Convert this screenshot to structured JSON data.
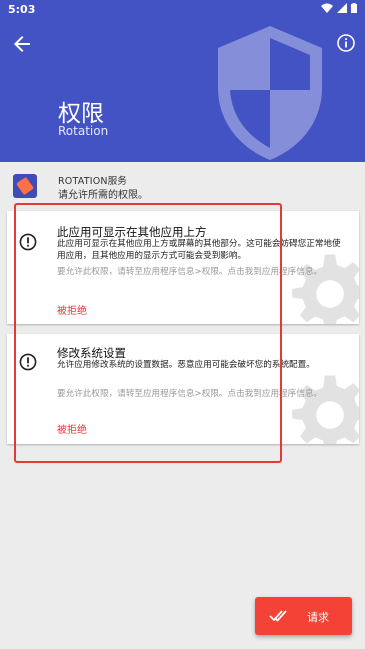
{
  "status_bar": {
    "time": "5:03"
  },
  "header": {
    "title": "权限",
    "subtitle": "Rotation",
    "background": "#4453c3"
  },
  "app_info": {
    "name": "ROTATION服务",
    "description": "请允许所需的权限。"
  },
  "permissions": [
    {
      "title": "此应用可显示在其他应用上方",
      "description": "此应用可显示在其他应用上方或屏幕的其他部分。这可能会妨碍您正常地使用应用，且其他应用的显示方式可能会受到影响。",
      "hint": "要允许此权限，请转至应用程序信息>权限。点击我到应用程序信息。",
      "status": "被拒绝"
    },
    {
      "title": "修改系统设置",
      "description": "允许应用修改系统的设置数据。恶意应用可能会破坏您的系统配置。",
      "hint": "要允许此权限，请转至应用程序信息>权限。点击我到应用程序信息。",
      "status": "被拒绝"
    }
  ],
  "fab": {
    "label": "请求",
    "color": "#f44336"
  },
  "icons": {
    "back": "arrow-back-icon",
    "info": "info-icon",
    "shield": "shield-icon",
    "warning": "alert-circle-icon",
    "request": "double-check-icon"
  }
}
